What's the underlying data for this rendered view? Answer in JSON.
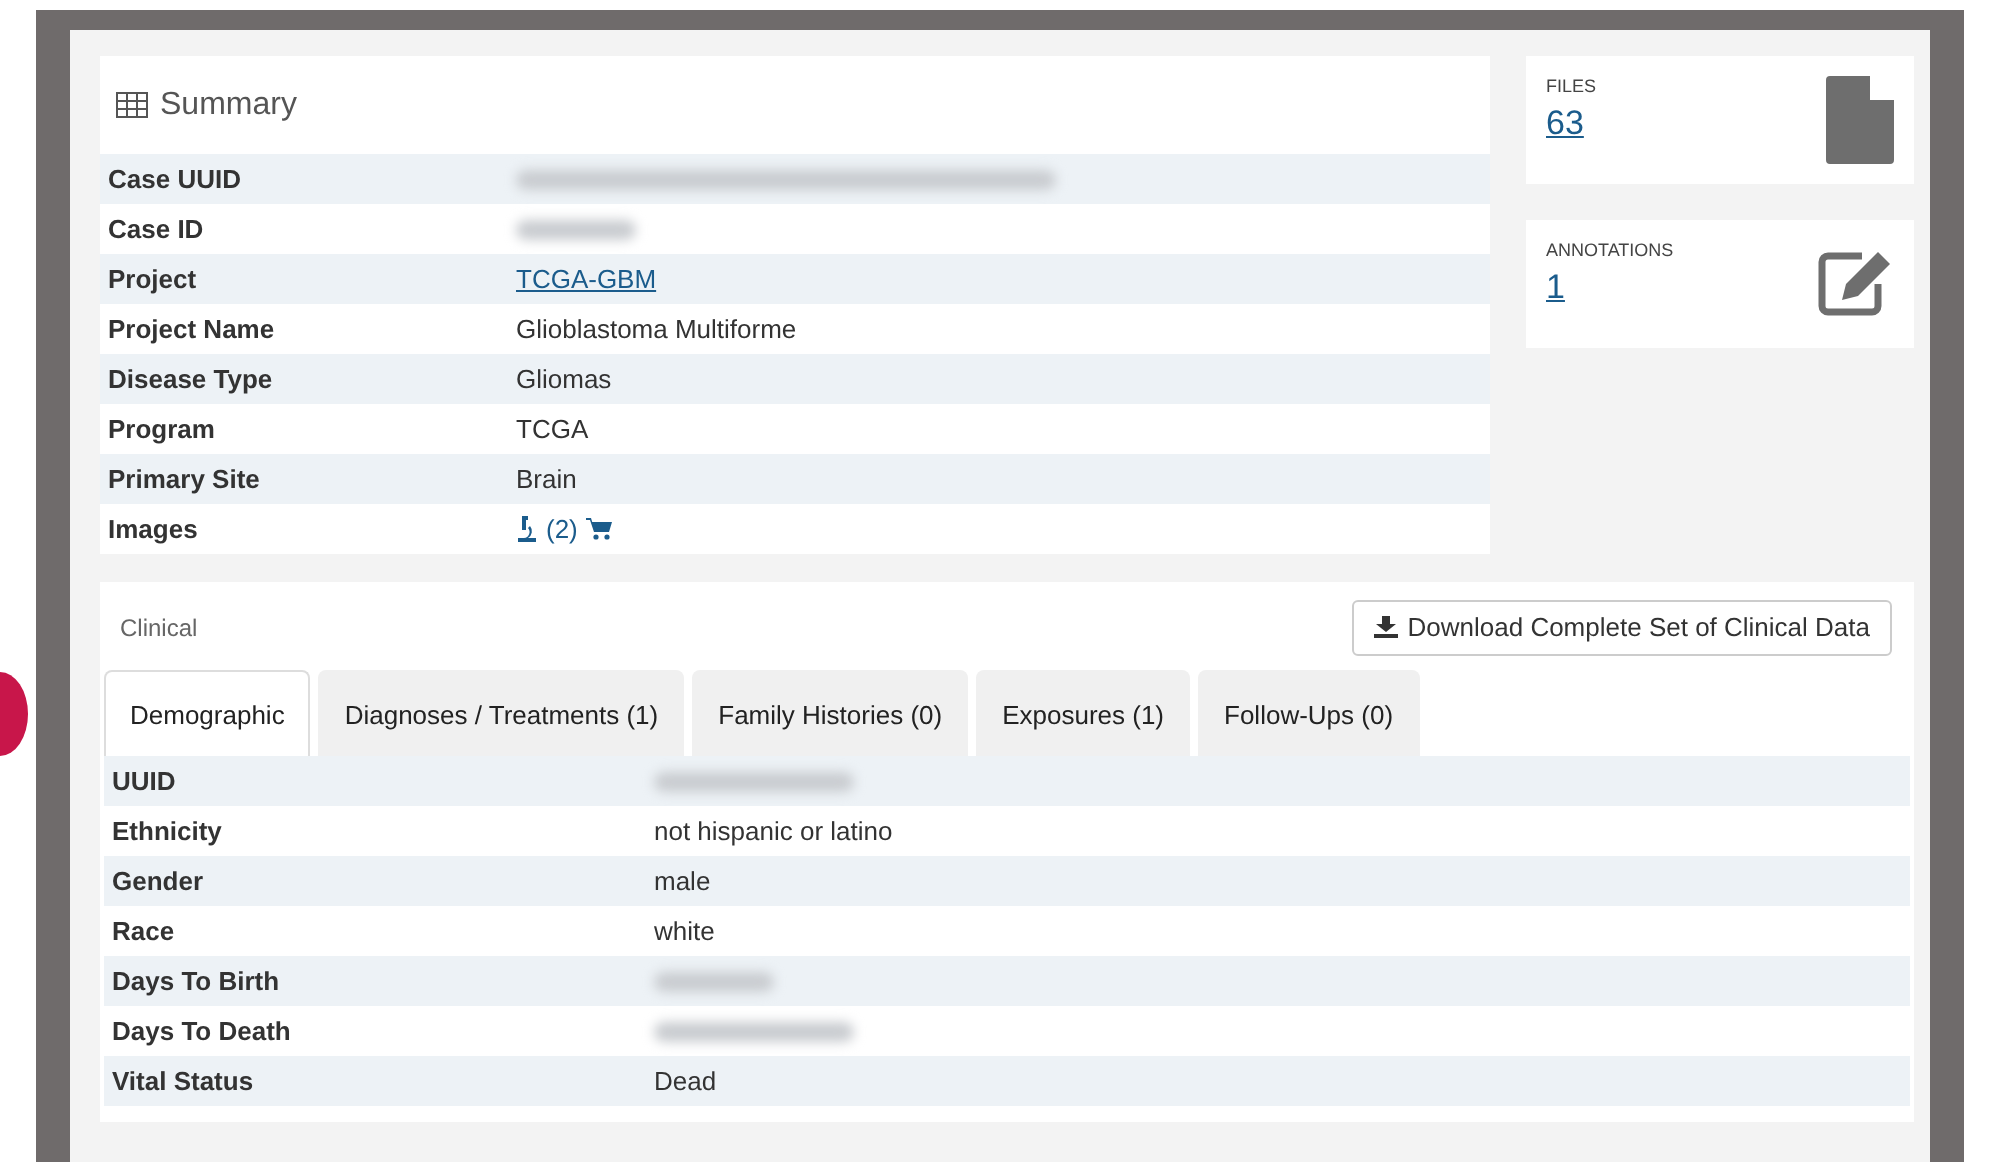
{
  "summary": {
    "title": "Summary",
    "rows": [
      {
        "label": "Case UUID",
        "redacted": true
      },
      {
        "label": "Case ID",
        "redacted": true
      },
      {
        "label": "Project",
        "value": "TCGA-GBM",
        "kind": "link"
      },
      {
        "label": "Project Name",
        "value": "Glioblastoma Multiforme",
        "kind": "text"
      },
      {
        "label": "Disease Type",
        "value": "Gliomas",
        "kind": "text"
      },
      {
        "label": "Program",
        "value": "TCGA",
        "kind": "text"
      },
      {
        "label": "Primary Site",
        "value": "Brain",
        "kind": "text"
      },
      {
        "label": "Images",
        "value": "(2)",
        "kind": "images"
      }
    ]
  },
  "counts": [
    {
      "label": "FILES",
      "value": "63",
      "kind": "file"
    },
    {
      "label": "ANNOTATIONS",
      "value": "1",
      "kind": "edit"
    }
  ],
  "clinical": {
    "title": "Clinical",
    "download_button": "Download Complete Set of Clinical Data",
    "tabs": [
      {
        "label": "Demographic",
        "selected": true
      },
      {
        "label": "Diagnoses / Treatments (1)",
        "selected": false
      },
      {
        "label": "Family Histories (0)",
        "selected": false
      },
      {
        "label": "Exposures (1)",
        "selected": false
      },
      {
        "label": "Follow-Ups (0)",
        "selected": false
      }
    ],
    "rows": [
      {
        "label": "UUID",
        "redacted": true
      },
      {
        "label": "Ethnicity",
        "value": "not hispanic or latino"
      },
      {
        "label": "Gender",
        "value": "male"
      },
      {
        "label": "Race",
        "value": "white"
      },
      {
        "label": "Days To Birth",
        "redacted": true
      },
      {
        "label": "Days To Death",
        "redacted": true
      },
      {
        "label": "Vital Status",
        "value": "Dead"
      }
    ]
  }
}
